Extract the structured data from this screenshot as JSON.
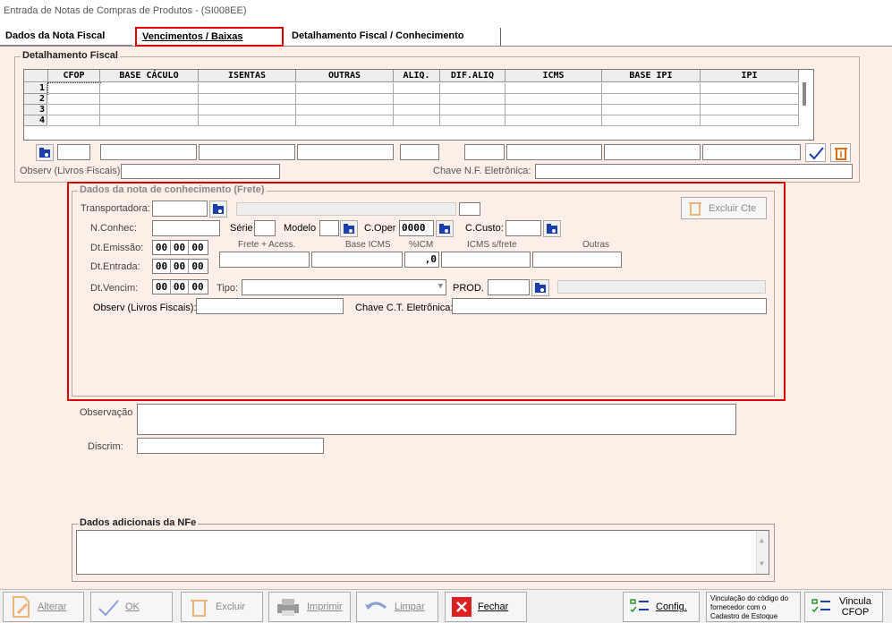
{
  "window": {
    "title": "Entrada de Notas de Compras de Produtos  - (SI008EE)"
  },
  "tabs": [
    {
      "label": "Dados da Nota Fiscal"
    },
    {
      "label": "Vencimentos / Baixas"
    },
    {
      "label": "Detalhamento Fiscal / Conhecimento"
    }
  ],
  "fiscal": {
    "group_title": "Detalhamento Fiscal",
    "columns": [
      "CFOP",
      "BASE CÁCULO",
      "ISENTAS",
      "OUTRAS",
      "ALIQ.",
      "DIF.ALIQ",
      "ICMS",
      "BASE IPI",
      "IPI"
    ],
    "rows": [
      "1",
      "2",
      "3",
      "4"
    ],
    "observ_label": "Observ (Livros Fiscais):",
    "chave_label": "Chave N.F. Eletrônica:"
  },
  "frete": {
    "group_title": "Dados da nota de conhecimento (Frete)",
    "transportadora_label": "Transportadora:",
    "excluir_cte_label": "Excluir Cte",
    "nconhec_label": "N.Conhec:",
    "serie_label": "Série",
    "modelo_label": "Modelo",
    "coper_label": "C.Oper",
    "coper_value": "0000",
    "ccusto_label": "C.Custo:",
    "dtemissao_label": "Dt.Emissão:",
    "dtentrada_label": "Dt.Entrada:",
    "dtvencim_label": "Dt.Vencim:",
    "date_parts": [
      "00",
      "00",
      "00"
    ],
    "frete_acess_label": "Frete + Acess.",
    "base_icms_label": "Base ICMS",
    "pct_icm_label": "%ICM",
    "pct_icm_value": ",0",
    "icms_frete_label": "ICMS s/frete",
    "outras_label": "Outras",
    "tipo_label": "Tipo:",
    "prod_label": "PROD.",
    "observ_label": "Observ (Livros Fiscais):",
    "chave_cte_label": "Chave C.T. Eletrônica:"
  },
  "observacao_label": "Observação",
  "discrim_label": "Discrim:",
  "nfe": {
    "group_title": "Dados adicionais da NFe"
  },
  "buttons": {
    "alterar": "Alterar",
    "ok": "OK",
    "excluir": "Excluir",
    "imprimir": "Imprimir",
    "limpar": "Limpar",
    "fechar": "Fechar",
    "config": "Config.",
    "vinculacao": "Vinculação do código do fornecedor com o Cadastro de Estoque",
    "vincula_cfop": "Vincula CFOP"
  },
  "colors": {
    "accent": "#e10000",
    "background": "#fdeee8",
    "lookup": "#1c3ea8"
  }
}
